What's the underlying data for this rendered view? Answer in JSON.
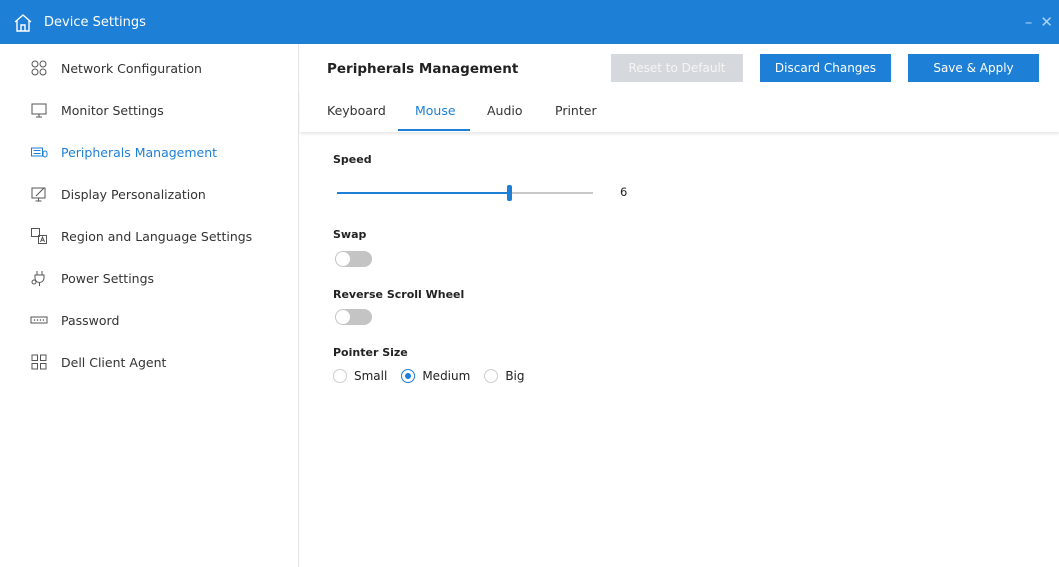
{
  "window": {
    "title": "Device Settings",
    "minimize_glyph": "–",
    "close_glyph": "✕",
    "accent_color": "#1d7fd6"
  },
  "sidebar": {
    "items": [
      {
        "label": "Network Configuration",
        "icon": "network-icon",
        "active": false
      },
      {
        "label": "Monitor Settings",
        "icon": "monitor-icon",
        "active": false
      },
      {
        "label": "Peripherals Management",
        "icon": "keyboard-mouse-icon",
        "active": true
      },
      {
        "label": "Display Personalization",
        "icon": "display-pen-icon",
        "active": false
      },
      {
        "label": "Region and Language Settings",
        "icon": "language-icon",
        "active": false
      },
      {
        "label": "Power Settings",
        "icon": "power-plug-icon",
        "active": false
      },
      {
        "label": "Password",
        "icon": "password-icon",
        "active": false
      },
      {
        "label": "Dell Client Agent",
        "icon": "apps-grid-icon",
        "active": false
      }
    ]
  },
  "header": {
    "title": "Peripherals Management",
    "reset_label": "Reset to Default",
    "discard_label": "Discard Changes",
    "save_label": "Save & Apply"
  },
  "tabs": [
    {
      "label": "Keyboard",
      "active": false
    },
    {
      "label": "Mouse",
      "active": true
    },
    {
      "label": "Audio",
      "active": false
    },
    {
      "label": "Printer",
      "active": false
    }
  ],
  "mouse": {
    "speed_label": "Speed",
    "speed_value": "6",
    "speed_fraction": 0.67,
    "swap_label": "Swap",
    "swap_on": false,
    "reverse_label": "Reverse Scroll Wheel",
    "reverse_on": false,
    "pointer_label": "Pointer Size",
    "pointer_options": [
      "Small",
      "Medium",
      "Big"
    ],
    "pointer_selected": "Medium"
  }
}
